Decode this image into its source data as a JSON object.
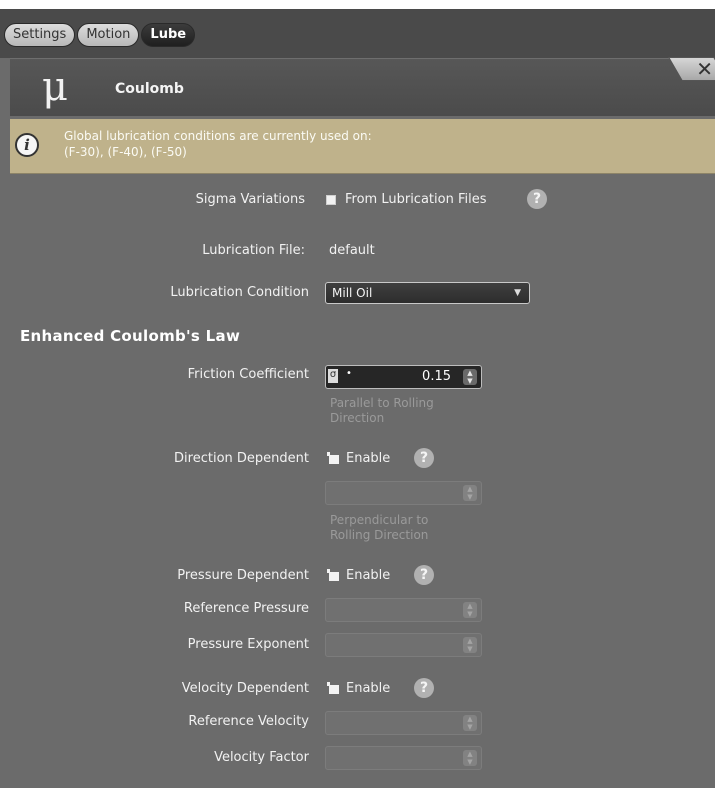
{
  "tabs": [
    {
      "label": "Settings",
      "active": false
    },
    {
      "label": "Motion",
      "active": false
    },
    {
      "label": "Lube",
      "active": true
    }
  ],
  "header": {
    "symbol": "μ",
    "title": "Coulomb",
    "close_glyph": "✕"
  },
  "info": {
    "icon": "info-icon",
    "line1": "Global lubrication conditions are currently used on:",
    "line2": "(F-30), (F-40), (F-50)"
  },
  "sigma": {
    "label": "Sigma Variations",
    "checkbox_text": "From Lubrication Files",
    "help": "?"
  },
  "lube_file": {
    "label": "Lubrication File:",
    "value": "default"
  },
  "lube_condition": {
    "label": "Lubrication Condition",
    "value": "Mill Oil"
  },
  "section_title": "Enhanced Coulomb's Law",
  "friction": {
    "label": "Friction Coefficient",
    "sigma_glyph": "σ",
    "value": "0.15",
    "hint1": "Parallel to Rolling",
    "hint2": "Direction"
  },
  "direction": {
    "label": "Direction Dependent",
    "enable": "Enable",
    "help": "?",
    "hint1": "Perpendicular to",
    "hint2": "Rolling Direction"
  },
  "pressure": {
    "label": "Pressure Dependent",
    "enable": "Enable",
    "help": "?",
    "ref_label": "Reference Pressure",
    "exp_label": "Pressure Exponent"
  },
  "velocity": {
    "label": "Velocity Dependent",
    "enable": "Enable",
    "help": "?",
    "ref_label": "Reference Velocity",
    "factor_label": "Velocity Factor"
  },
  "colors": {
    "panel": "#6b6b6b",
    "info_bg": "#bfb28b",
    "dark_header": "#4b4b4b"
  }
}
